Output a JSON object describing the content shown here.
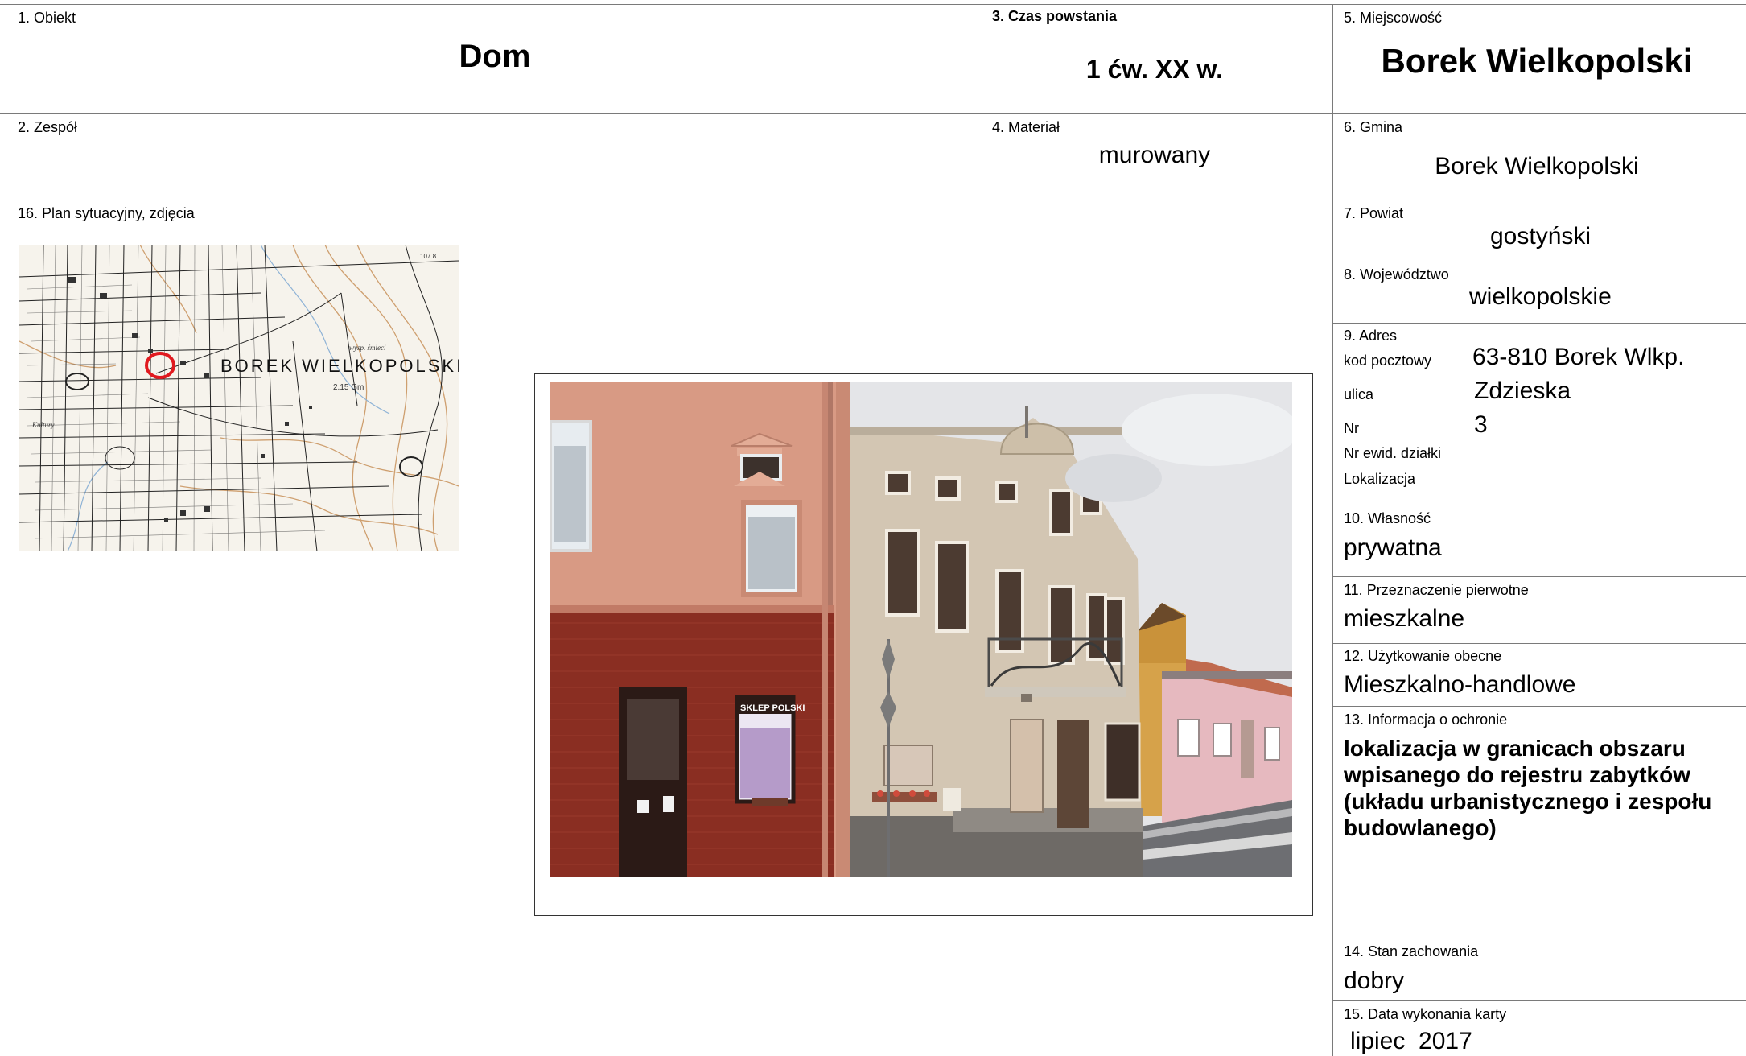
{
  "fields": {
    "obiekt": {
      "label": "1. Obiekt",
      "value": "Dom"
    },
    "zespol": {
      "label": "2. Zespół",
      "value": ""
    },
    "czas": {
      "label": "3. Czas powstania",
      "value": "1 ćw. XX w."
    },
    "material": {
      "label": "4. Materiał",
      "value": "murowany"
    },
    "miejscowosc": {
      "label": "5. Miejscowość",
      "value": "Borek Wielkopolski"
    },
    "gmina": {
      "label": "6. Gmina",
      "value": "Borek Wielkopolski"
    },
    "powiat": {
      "label": "7. Powiat",
      "value": "gostyński"
    },
    "wojewodztwo": {
      "label": "8. Województwo",
      "value": "wielkopolskie"
    },
    "adres": {
      "label": "9. Adres",
      "kod_label": "kod pocztowy",
      "kod_value": "63-810 Borek Wlkp.",
      "ulica_label": "ulica",
      "ulica_value": "Zdzieska",
      "nr_label": "Nr",
      "nr_value": "3",
      "dzialka_label": "Nr ewid. działki",
      "lokalizacja_label": "Lokalizacja"
    },
    "wlasnosc": {
      "label": "10. Własność",
      "value": "prywatna"
    },
    "przeznaczenie": {
      "label": "11. Przeznaczenie pierwotne",
      "value": "mieszkalne"
    },
    "uzytkowanie": {
      "label": "12. Użytkowanie obecne",
      "value": "Mieszkalno-handlowe"
    },
    "ochrona": {
      "label": "13. Informacja o ochronie",
      "lines": [
        "lokalizacja w granicach obszaru",
        "wpisanego do rejestru zabytków",
        "(układu urbanistycznego i zespołu",
        "budowlanego)"
      ]
    },
    "stan": {
      "label": "14. Stan zachowania",
      "value": "dobry"
    },
    "data": {
      "label": "15. Data wykonania karty",
      "value": "lipiec  2017"
    },
    "plan": {
      "label": "16. Plan sytuacyjny, zdjęcia"
    }
  },
  "map": {
    "town_label": "BOREK WIELKOPOLSKI",
    "label_wysp": "wysp. śmieci",
    "label_gm": "2.15 Gm",
    "label_elev": "107.8",
    "label_kultury": "Kultury",
    "marker_color": "#e0191f"
  },
  "photo": {
    "shop_sign": "SKLEP POLSKI"
  }
}
